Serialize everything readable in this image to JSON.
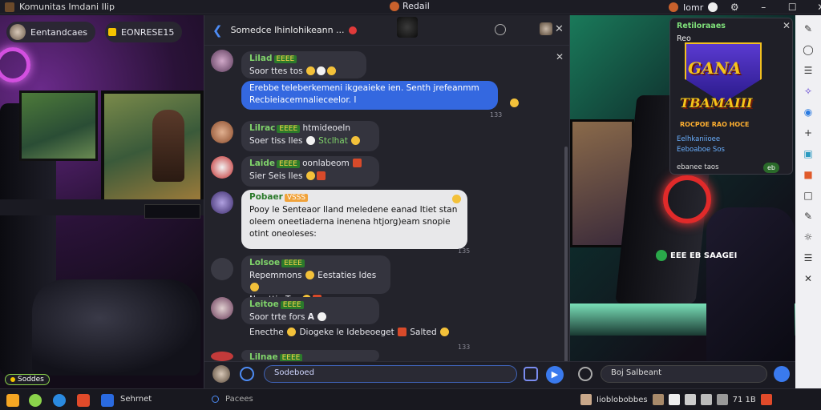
{
  "window": {
    "title": "Komunitas Imdani Ilip",
    "center_title": "Redail",
    "user_label": "Iomr"
  },
  "left_stream": {
    "pill1": "Eentandcaes",
    "pill2": "EONRESE15",
    "badge": "Soddes"
  },
  "chat": {
    "header_title": "Somedce Ihinlohikeann ...",
    "messages": [
      {
        "name": "Lilad",
        "tag": "EEEE",
        "text": "Soor ttes tos",
        "time": ""
      },
      {
        "name": "",
        "tag": "",
        "text": "Erebbe teleberkemeni ikgeaieke ien. Senth jrefeanmm Recbieiacemnalieceelor. I",
        "time": "133"
      },
      {
        "name": "Lilrac",
        "tag": "EEEE",
        "extra": "htmideoeln",
        "text": "Soer tiss Iles",
        "suffix": "Stclhat",
        "time": ""
      },
      {
        "name": "Laide",
        "tag": "EEEE",
        "extra": "oonlabeom",
        "text": "Sier Seis Iles",
        "time": ""
      },
      {
        "name": "Pobaer",
        "tag": "VSSS",
        "text": "Pooy le Senteaor Iland meledene eanad Itiet stan oleem oneetiaderna inenena htjorg)eam snopie otint oneoleses:",
        "time": "135"
      },
      {
        "name": "Lolsoe",
        "tag": "EEEE",
        "text": "Repemmons",
        "extra": "Eestaties Ides",
        "line2": "Nee ttie Tes",
        "time": ""
      },
      {
        "name": "Leitoe",
        "tag": "EEEE",
        "text": "Soor trte fors",
        "extra": "A",
        "line2": "Enecthe",
        "line2b": "Diogeke le Idebeoeget",
        "line2c": "Salted",
        "time": "133"
      },
      {
        "name": "Lilnae",
        "tag": "EEEE",
        "text": "",
        "time": ""
      }
    ],
    "composer_placeholder": "Sodeboed"
  },
  "ad": {
    "h1": "Retiloraaes",
    "h2": "Reo",
    "logo1": "GANA",
    "logo2": "TBAMAIII",
    "sub": "ROCPOE RAO HOCE",
    "line1": "Eelhkaniioee",
    "line2": "Eeboaboe Sos",
    "line3": "ebanee taos",
    "toggle": "eb"
  },
  "right_stream": {
    "live_label": "EEE EB SAAGEI",
    "composer_placeholder": "Boj Salbeant"
  },
  "taskbar": {
    "label": "Sehrnet",
    "mid": "Pacees",
    "right": "Iioblobobbes",
    "clock": "71 1B"
  },
  "colors": {
    "accent": "#3468e0",
    "chat_bg": "#23232b",
    "username_green": "#7fd36a"
  }
}
